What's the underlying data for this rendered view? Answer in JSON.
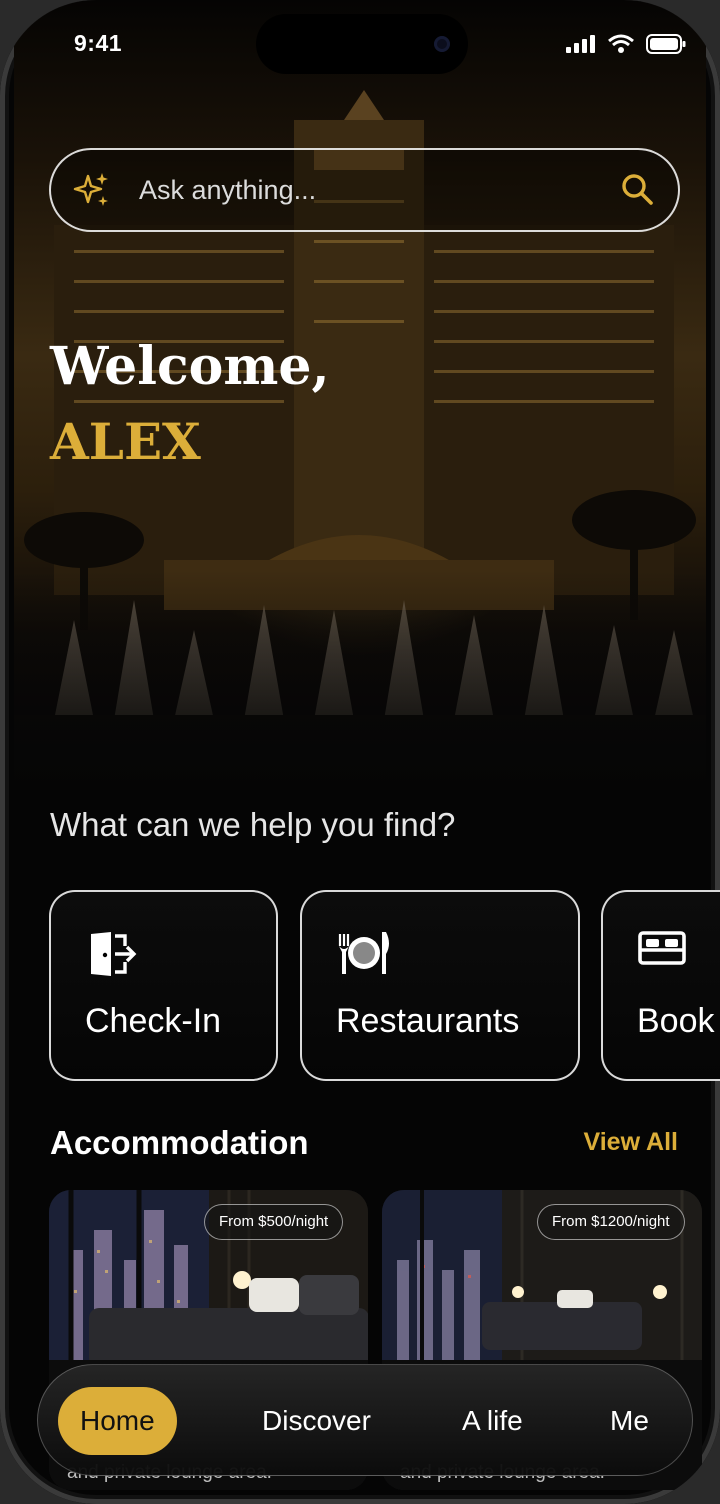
{
  "status_bar": {
    "time": "9:41"
  },
  "search": {
    "placeholder": "Ask anything..."
  },
  "hero": {
    "greeting": "Welcome,",
    "user_name": "ALEX"
  },
  "help": {
    "title": "What can we help you find?"
  },
  "quick_actions": [
    {
      "label": "Check-In",
      "icon": "door-exit-icon"
    },
    {
      "label": "Restaurants",
      "icon": "plate-cutlery-icon"
    },
    {
      "label": "Book",
      "icon": "bed-icon"
    }
  ],
  "accommodation": {
    "title": "Accommodation",
    "view_all": "View All",
    "rooms": [
      {
        "price": "From $500/night",
        "description": "and private lounge area."
      },
      {
        "price": "From $1200/night",
        "description": "and private lounge area."
      }
    ]
  },
  "bottom_nav": {
    "items": [
      {
        "label": "Home",
        "active": true
      },
      {
        "label": "Discover",
        "active": false
      },
      {
        "label": "A life",
        "active": false
      },
      {
        "label": "Me",
        "active": false
      }
    ]
  },
  "colors": {
    "accent": "#dcae39",
    "background": "#050505",
    "text": "#ffffff"
  }
}
